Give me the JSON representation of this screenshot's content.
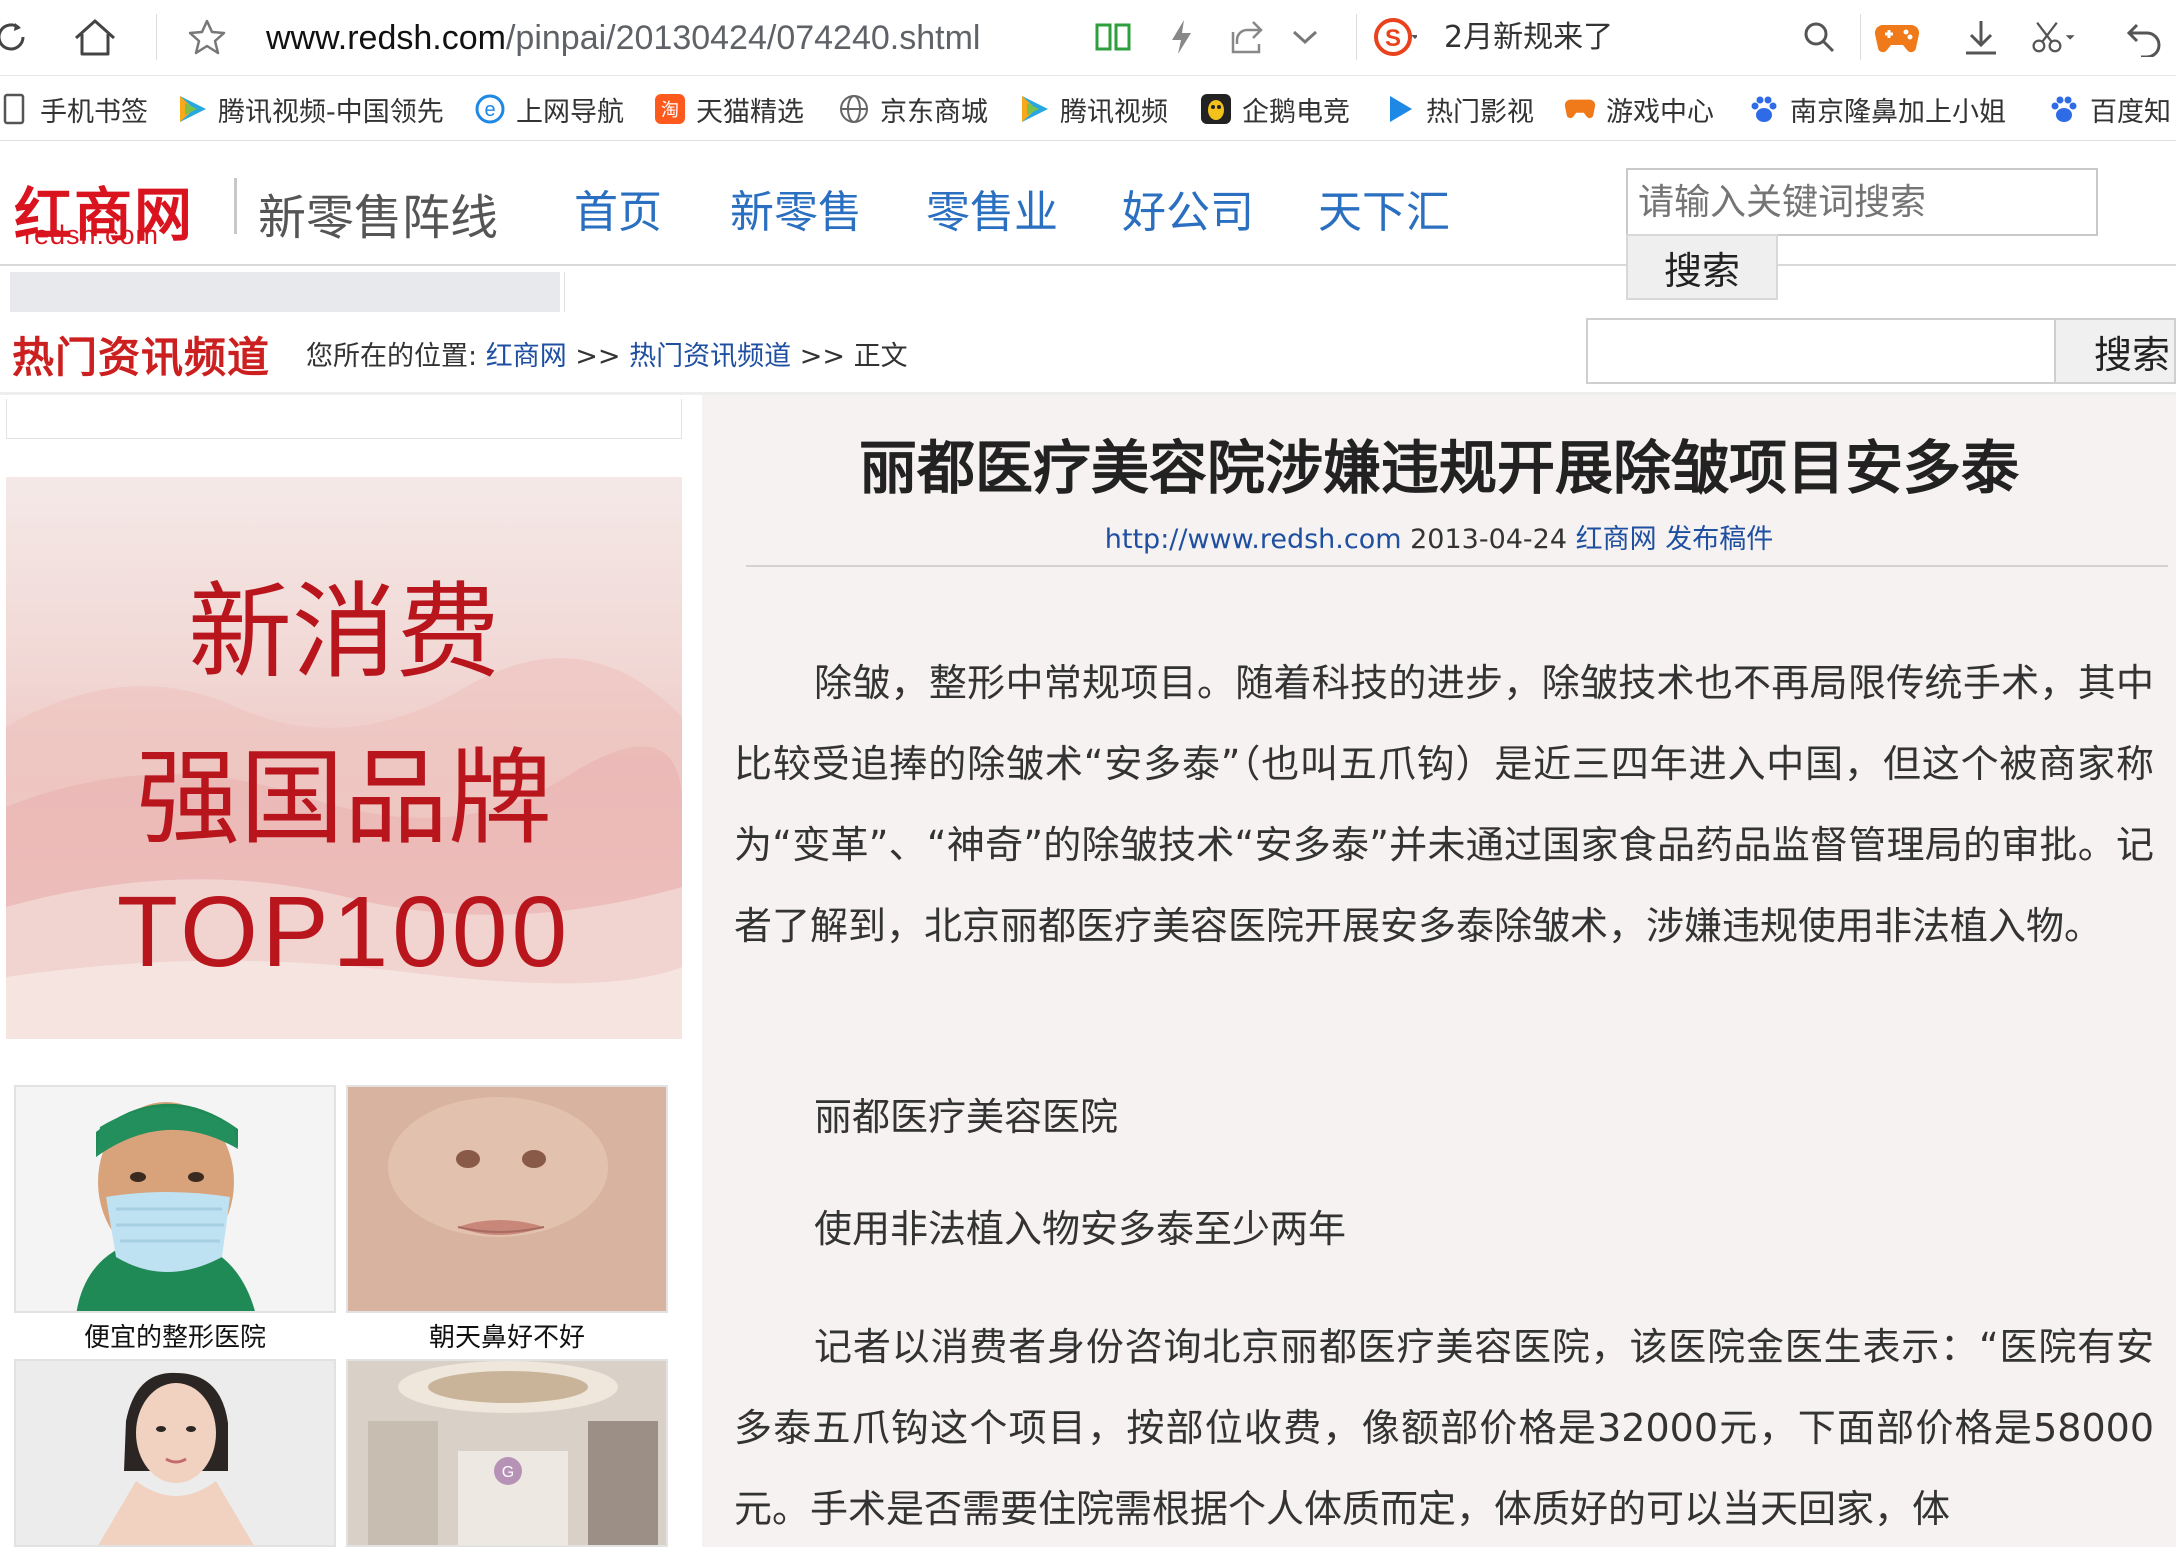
{
  "browser": {
    "url_host": "www.redsh.com",
    "url_path": "/pinpai/20130424/074240.shtml",
    "notice": "2月新规来了"
  },
  "bookmarks": [
    {
      "label": "手机书签",
      "icon": "mobile-bookmark-icon"
    },
    {
      "label": "腾讯视频-中国领先",
      "icon": "tencent-video-icon"
    },
    {
      "label": "上网导航",
      "icon": "ie-icon"
    },
    {
      "label": "天猫精选",
      "icon": "tmall-icon"
    },
    {
      "label": "京东商城",
      "icon": "globe-icon"
    },
    {
      "label": "腾讯视频",
      "icon": "tencent-video-icon"
    },
    {
      "label": "企鹅电竞",
      "icon": "penguin-esports-icon"
    },
    {
      "label": "热门影视",
      "icon": "play-icon"
    },
    {
      "label": "游戏中心",
      "icon": "gamepad-icon"
    },
    {
      "label": "南京隆鼻加上小姐",
      "icon": "baidu-paw-icon"
    },
    {
      "label": "百度知",
      "icon": "baidu-paw-icon"
    }
  ],
  "site": {
    "logo_cn": "红商网",
    "logo_en": "redsh.com",
    "slogan": "新零售阵线",
    "nav": [
      "首页",
      "新零售",
      "零售业",
      "好公司",
      "天下汇"
    ],
    "search_placeholder": "请输入关键词搜索",
    "search_button": "搜索"
  },
  "channel": {
    "title": "热门资讯频道",
    "breadcrumb_prefix": "您所在的位置:",
    "breadcrumb_home": "红商网",
    "breadcrumb_sep": ">>",
    "breadcrumb_channel": "热门资讯频道",
    "breadcrumb_current": "正文",
    "search_button": "搜索"
  },
  "sidebar": {
    "banner_lines": [
      "新消费",
      "强国品牌",
      "TOP1000"
    ],
    "thumbs": [
      {
        "caption": "便宜的整形医院"
      },
      {
        "caption": "朝天鼻好不好"
      },
      {
        "caption": ""
      },
      {
        "caption": ""
      }
    ]
  },
  "article": {
    "title": "丽都医疗美容院涉嫌违规开展除皱项目安多泰",
    "meta_url": "http://www.redsh.com",
    "meta_date": "2013-04-24",
    "meta_source": "红商网 发布稿件",
    "paragraphs": [
      "除皱，整形中常规项目。随着科技的进步，除皱技术也不再局限传统手术，其中比较受追捧的除皱术“安多泰”（也叫五爪钩）是近三四年进入中国，但这个被商家称为“变革”、“神奇”的除皱技术“安多泰”并未通过国家食品药品监督管理局的审批。记者了解到，北京丽都医疗美容医院开展安多泰除皱术，涉嫌违规使用非法植入物。",
      "丽都医疗美容医院",
      "使用非法植入物安多泰至少两年",
      "记者以消费者身份咨询北京丽都医疗美容医院，该医院金医生表示：“医院有安多泰五爪钩这个项目，按部位收费，像额部价格是32000元，下面部价格是58000元。手术是否需要住院需根据个人体质而定，体质好的可以当天回家，体"
    ]
  },
  "colors": {
    "brand_red": "#d9141e",
    "nav_blue": "#2a6fc0",
    "link_blue": "#1f4fa0",
    "article_bg": "#f6f2f1"
  }
}
